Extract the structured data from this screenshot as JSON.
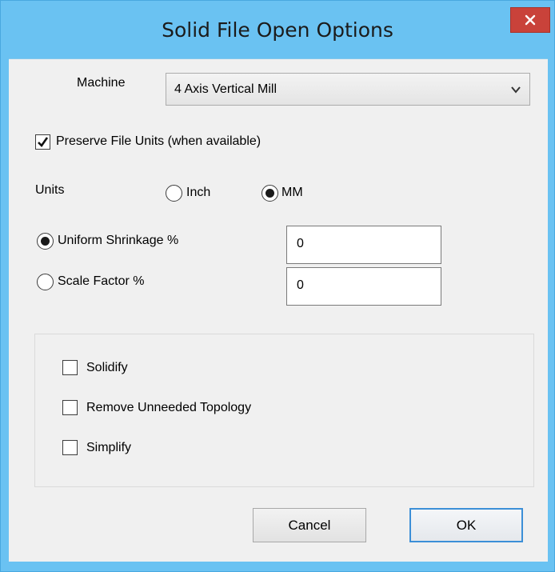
{
  "window": {
    "title": "Solid File Open Options",
    "close_icon": "close-icon",
    "accent": "#6ac2f2",
    "close_color": "#c9423a"
  },
  "machine": {
    "label": "Machine",
    "selected": "4 Axis Vertical Mill",
    "arrow_icon": "chevron-down-icon"
  },
  "preserve_units": {
    "label": "Preserve File Units (when available)",
    "checked": true
  },
  "units": {
    "label": "Units",
    "options": [
      {
        "label": "Inch",
        "selected": false
      },
      {
        "label": "MM",
        "selected": true
      }
    ]
  },
  "scaling": {
    "uniform_shrinkage": {
      "label": "Uniform Shrinkage %",
      "selected": true,
      "value": "0"
    },
    "scale_factor": {
      "label": "Scale Factor %",
      "selected": false,
      "value": "0"
    }
  },
  "options": [
    {
      "label": "Solidify",
      "checked": false
    },
    {
      "label": "Remove Unneeded Topology",
      "checked": false
    },
    {
      "label": "Simplify",
      "checked": false
    }
  ],
  "buttons": {
    "cancel": "Cancel",
    "ok": "OK"
  }
}
